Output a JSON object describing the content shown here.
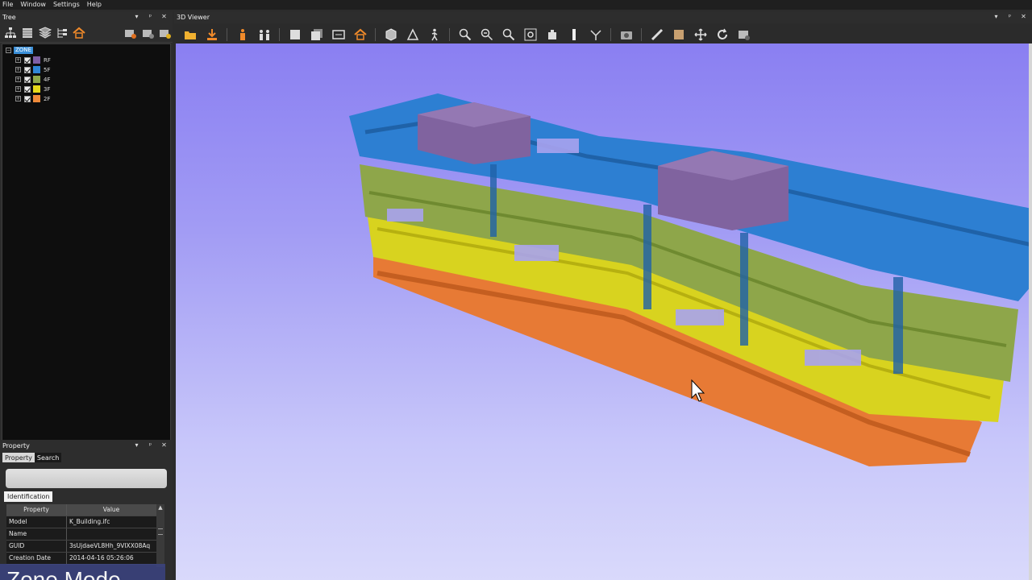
{
  "menu": [
    "File",
    "Window",
    "Settings",
    "Help"
  ],
  "tree_panel": {
    "title": "Tree",
    "root_label": "ZONE",
    "zones": [
      {
        "label": "RF",
        "color": "#7e5fa6"
      },
      {
        "label": "5F",
        "color": "#2f86d6"
      },
      {
        "label": "4F",
        "color": "#8fa84a"
      },
      {
        "label": "3F",
        "color": "#e5d81a"
      },
      {
        "label": "2F",
        "color": "#ef8a3a"
      }
    ],
    "toolbar_icons": [
      "hierarchy-icon",
      "list-icon",
      "layers-icon",
      "tree-icon",
      "zone-house-icon",
      "camera-add-icon",
      "camera-settings-icon",
      "camera-view-icon"
    ]
  },
  "property_panel": {
    "title": "Property",
    "tabs": [
      "Property",
      "Search"
    ],
    "section_tab": "Identification",
    "columns": [
      "Property",
      "Value"
    ],
    "rows": [
      {
        "property": "Model",
        "value": "K_Building.ifc"
      },
      {
        "property": "Name",
        "value": ""
      },
      {
        "property": "GUID",
        "value": "3sUjdaeVL8Hh_9VIXX08Aq"
      },
      {
        "property": "Creation Date",
        "value": "2014-04-16 05:26:06"
      }
    ]
  },
  "viewer": {
    "title": "3D Viewer",
    "toolbar_icons": [
      "open-folder-icon",
      "save-download-icon",
      "people-icon",
      "group-icon",
      "window-icon",
      "window-stack-icon",
      "fit-window-icon",
      "zone-house-icon",
      "cube-icon",
      "perspective-icon",
      "walk-icon",
      "zoom-in-icon",
      "zoom-out-icon",
      "zoom-select-icon",
      "zoom-extents-icon",
      "section-icon",
      "clip-icon",
      "fly-icon",
      "snapshot-icon",
      "measure-icon",
      "material-icon",
      "pan-icon",
      "rotate-icon",
      "properties-icon"
    ]
  },
  "overlay_caption": "Zone Mode",
  "colors": {
    "sky_top": "#8a7ff2",
    "sky_bottom": "#d9d9fb",
    "selection": "#3a8fd8"
  }
}
